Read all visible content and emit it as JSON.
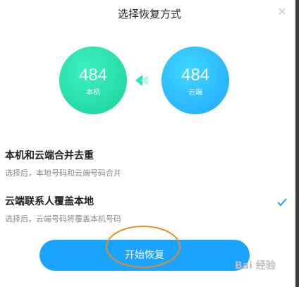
{
  "dialog": {
    "title": "选择恢复方式",
    "close_icon": "close-icon"
  },
  "sources": {
    "local": {
      "count": "484",
      "label": "本机",
      "color": "#1fe0a8"
    },
    "cloud": {
      "count": "484",
      "label": "云端",
      "color": "#26b2ff"
    },
    "arrow_icon": "arrow-left-icon"
  },
  "options": [
    {
      "title": "本机和云端合并去重",
      "desc": "选择后，本地号码和云端号码合并",
      "selected": false
    },
    {
      "title": "云端联系人覆盖本地",
      "desc": "选择后，云端号码将覆盖本机号码",
      "selected": true
    }
  ],
  "start_button": {
    "label": "开始恢复",
    "color": "#1aa3ff"
  },
  "annotation": {
    "color": "#e38c22"
  },
  "watermark": {
    "text": "Bai 经验"
  }
}
